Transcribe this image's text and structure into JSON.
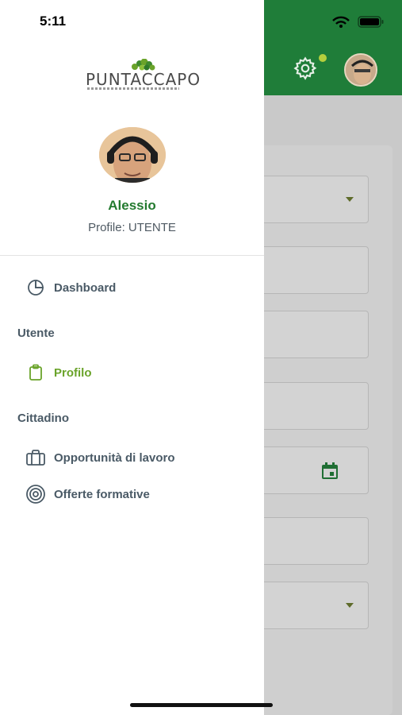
{
  "status_bar": {
    "time": "5:11"
  },
  "drawer": {
    "logo_text": "PUNTACCAPO",
    "user": {
      "name": "Alessio",
      "profile": "Profile: UTENTE"
    },
    "items": [
      {
        "label": "Dashboard",
        "icon": "pie-chart-icon"
      },
      {
        "section": "Utente"
      },
      {
        "label": "Profilo",
        "icon": "clipboard-icon",
        "active": true
      },
      {
        "section": "Cittadino"
      },
      {
        "label": "Opportunità di lavoro",
        "icon": "briefcase-icon"
      },
      {
        "label": "Offerte formative",
        "icon": "target-icon"
      }
    ]
  },
  "colors": {
    "header_green": "#1f7d39",
    "name_green": "#237a2f",
    "active_green": "#6aa32a",
    "text_gray": "#4a5a66"
  }
}
